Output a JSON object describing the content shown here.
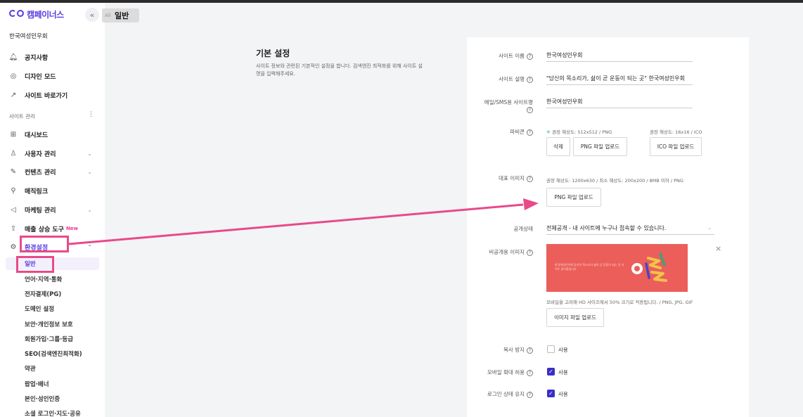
{
  "brand": {
    "name": "캠페이너스",
    "collapse_icon": "«"
  },
  "header": {
    "tab_title": "일반",
    "tab_prefix": "All"
  },
  "sidebar": {
    "site_name": "한국여성민우회",
    "top_items": [
      {
        "label": "공지사항",
        "icon": "bell-icon"
      },
      {
        "label": "디자인 모드",
        "icon": "palette-icon"
      },
      {
        "label": "사이트 바로가기",
        "icon": "external-link-icon"
      }
    ],
    "section_label": "사이트 관리",
    "section_more": "⋮",
    "manage_items": [
      {
        "label": "대시보드",
        "icon": "grid-icon",
        "chevron": ""
      },
      {
        "label": "사용자 관리",
        "icon": "user-icon",
        "chevron": "⌄"
      },
      {
        "label": "컨텐츠 관리",
        "icon": "edit-icon",
        "chevron": "⌄"
      },
      {
        "label": "매직링크",
        "icon": "magic-icon",
        "chevron": ""
      },
      {
        "label": "마케팅 관리",
        "icon": "megaphone-icon",
        "chevron": "⌄"
      },
      {
        "label": "매출 상승 도구",
        "icon": "chart-icon",
        "chevron": "",
        "badge": "New"
      }
    ],
    "settings": {
      "label": "환경설정",
      "icon": "gear-icon",
      "chevron": "⌃"
    },
    "sub_items": [
      "일반",
      "언어·지역·통화",
      "전자결제(PG)",
      "도메인 설정",
      "보안·개인정보 보호",
      "회원가입·그룹·등급",
      "SEO(검색엔진최적화)",
      "약관",
      "팝업·배너",
      "본인·성인인증",
      "소셜 로그인·지도·공유"
    ]
  },
  "section": {
    "title": "기본 설정",
    "description": "사이트 정보와 관련된 기본적인 설정을 합니다. 검색엔진 최적화를 위해 사이트 설명을 입력해주세요."
  },
  "form": {
    "site_name": {
      "label": "사이트 이름",
      "value": "한국여성민우회"
    },
    "site_desc": {
      "label": "사이트 설명",
      "value": "\"당신의 목소리가, 삶이 곧 운동이 되는 곳\" 한국여성민우회"
    },
    "sms_name": {
      "label": "메일/SMS용 사이트명",
      "value": "한국여성민우회"
    },
    "favicon": {
      "label": "파비콘",
      "png_hint": "권장 해상도: 512x512 / PNG",
      "ico_hint": "권장 해상도: 16x16 / ICO",
      "delete_label": "삭제",
      "png_upload_label": "PNG 파일 업로드",
      "ico_upload_label": "ICO 파일 업로드"
    },
    "rep_image": {
      "label": "대표 이미지",
      "hint": "권장 해상도: 1200x630 / 최소 해상도: 200x200 / 8MB 이하 / PNG",
      "upload_label": "PNG 파일 업로드"
    },
    "visibility": {
      "label": "공개상태",
      "value": "전체공개 - 내 사이트에 누구나 접속할 수 있습니다."
    },
    "private_image": {
      "label": "비공개용 이미지",
      "hint": "모바일을 고려해 HD 사이즈에서 50% 크기로 적용됩니다. / PNG, JPG, GIF",
      "upload_label": "이미지 파일 업로드",
      "close": "×",
      "image_text": "한국여성민우회 당신의 목소리가 삶이 곧 운동이 되는 곳 사이트 준비중입니다"
    },
    "copy_protect": {
      "label": "복사 방지",
      "option": "사용",
      "checked": false
    },
    "mobile_zoom": {
      "label": "모바일 확대 허용",
      "option": "사용",
      "checked": true
    },
    "keep_login": {
      "label": "로그인 상태 유지",
      "option": "사용",
      "checked": true
    },
    "help_glyph": "?"
  },
  "colors": {
    "accent": "#5a3be0",
    "annotation": "#e84a8a",
    "checkbox": "#3a2ec4",
    "og_bg": "#eb5e5a"
  }
}
